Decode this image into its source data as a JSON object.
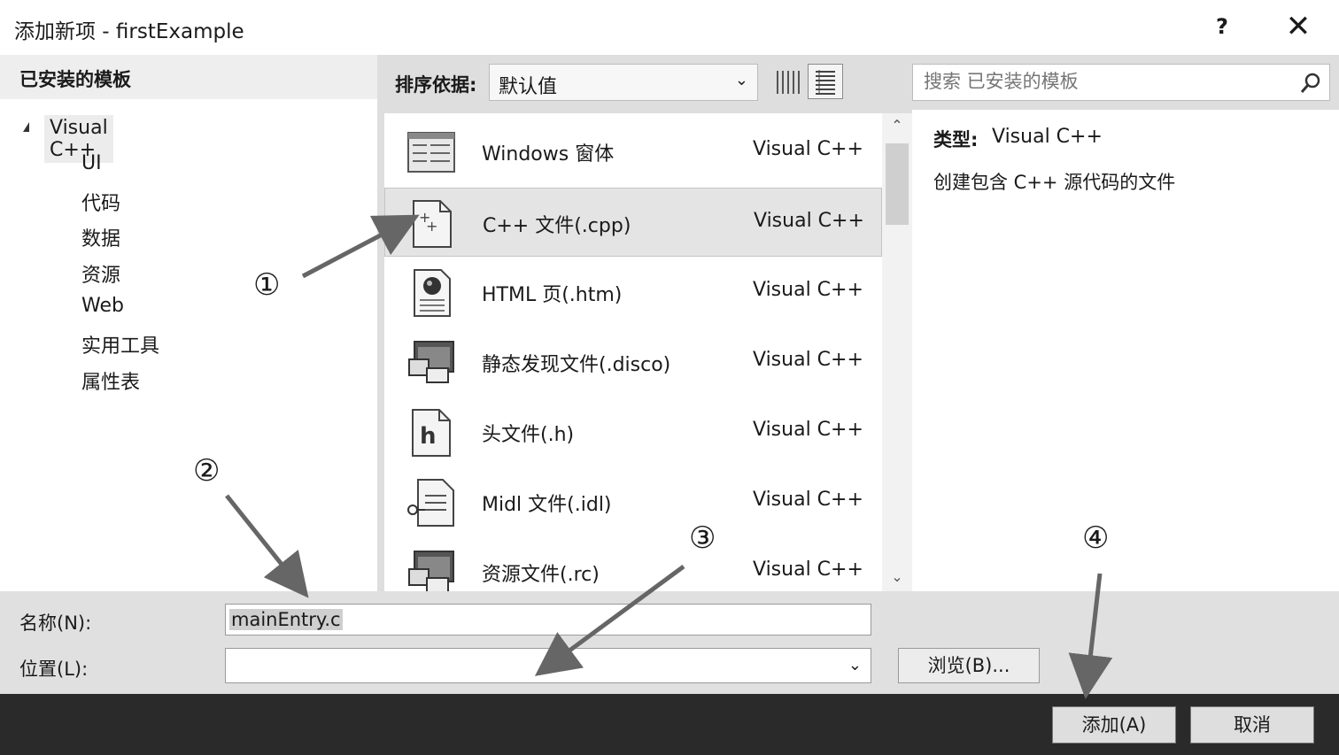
{
  "window": {
    "title": "添加新项 - firstExample",
    "help": "?",
    "close": "✕"
  },
  "left_panel": {
    "header": "已安装的模板",
    "root": "Visual C++",
    "children": [
      "UI",
      "代码",
      "数据",
      "资源",
      "Web",
      "实用工具",
      "属性表"
    ]
  },
  "toolbar": {
    "sort_label": "排序依据:",
    "sort_value": "默认值",
    "search_placeholder": "搜索 已安装的模板"
  },
  "templates": [
    {
      "name": "Windows 窗体",
      "lang": "Visual C++",
      "icon": "form-icon"
    },
    {
      "name": "C++ 文件(.cpp)",
      "lang": "Visual C++",
      "icon": "cpp-file-icon",
      "selected": true
    },
    {
      "name": "HTML 页(.htm)",
      "lang": "Visual C++",
      "icon": "html-page-icon"
    },
    {
      "name": "静态发现文件(.disco)",
      "lang": "Visual C++",
      "icon": "disco-file-icon"
    },
    {
      "name": "头文件(.h)",
      "lang": "Visual C++",
      "icon": "header-file-icon"
    },
    {
      "name": "Midl 文件(.idl)",
      "lang": "Visual C++",
      "icon": "idl-file-icon"
    },
    {
      "name": "资源文件(.rc)",
      "lang": "Visual C++",
      "icon": "resource-file-icon"
    }
  ],
  "details": {
    "type_label": "类型:",
    "type_value": "Visual C++",
    "description": "创建包含 C++ 源代码的文件"
  },
  "form": {
    "name_label": "名称(N):",
    "name_value": "mainEntry.c",
    "location_label": "位置(L):",
    "location_value": "",
    "browse": "浏览(B)..."
  },
  "footer": {
    "add": "添加(A)",
    "cancel": "取消"
  },
  "annotations": [
    "①",
    "②",
    "③",
    "④"
  ]
}
